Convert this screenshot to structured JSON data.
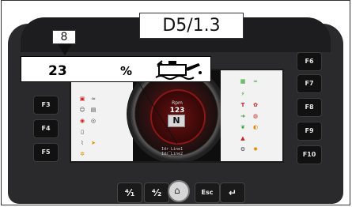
{
  "title": "D5/1.3",
  "marker_number": "8",
  "callout": {
    "value": "23",
    "unit": "%",
    "icon": "engine-oil-icon"
  },
  "softkeys_left": [
    "F3",
    "F4",
    "F5"
  ],
  "softkeys_right": [
    "F6",
    "F7",
    "F8",
    "F9",
    "F10"
  ],
  "gauge": {
    "rpm_label": "Rpm",
    "rpm_value": "123",
    "gear": "N"
  },
  "info_lines": [
    "Idr_Line1",
    "Idr_Line2"
  ],
  "bottom_buttons": [
    {
      "label": "⁴⁄₁",
      "icon": "speed-down-icon"
    },
    {
      "label": "⁴⁄₂",
      "icon": "speed-up-icon"
    },
    {
      "label": "",
      "icon": "home-icon"
    },
    {
      "label": "Esc",
      "icon": ""
    },
    {
      "label": "↵",
      "icon": "enter-icon"
    }
  ],
  "colors": {
    "lcd_bg": "#0e0e0e",
    "gauge_red": "#8a1616",
    "console": "#2a2a2c"
  }
}
